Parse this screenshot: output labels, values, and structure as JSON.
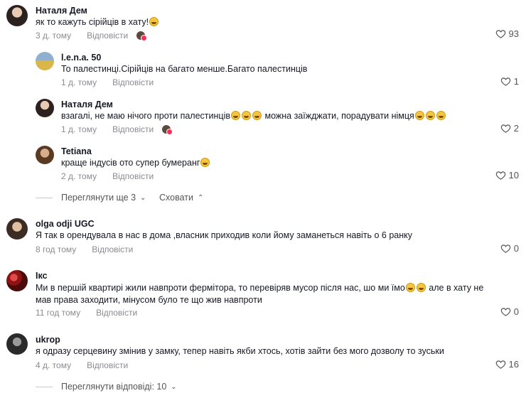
{
  "comments": [
    {
      "username": "Наталя Дем",
      "text": "як то кажуть сірійців в хату!",
      "time": "3 д. тому",
      "reply": "Відповісти",
      "likes": "93"
    },
    {
      "username": "l.e.n.a. 50",
      "text": "То палестинці.Сірійців на багато менше.Багато палестинців",
      "time": "1 д. тому",
      "reply": "Відповісти",
      "likes": "1"
    },
    {
      "username": "Наталя Дем",
      "text_a": "взагалі, не маю нічого проти палестинців",
      "text_b": " можна заїжджати, порадувати німця",
      "time": "1 д. тому",
      "reply": "Відповісти",
      "likes": "2"
    },
    {
      "username": "Tetiana",
      "text": "краще індусів ото супер бумеранг",
      "time": "2 д. тому",
      "reply": "Відповісти",
      "likes": "10"
    },
    {
      "username": "olga odji UGC",
      "text": "Я так в орендувала в нас в дома ,власник приходив коли йому заманеться навіть о 6 ранку",
      "time": "8 год тому",
      "reply": "Відповісти",
      "likes": "0"
    },
    {
      "username": "Ікс",
      "text_a": "Ми в першій квартирі жили навпроти фермітора, то перевіряв мусор після нас, шо ми їмо",
      "text_b": " але в хату не мав права заходити, мінусом було те що жив навпроти",
      "time": "11 год тому",
      "reply": "Відповісти",
      "likes": "0"
    },
    {
      "username": "ukrop",
      "text": "я одразу серцевину змінив у замку, тепер навіть якби хтось, хотів зайти без мого дозволу то зуськи",
      "time": "4 д. тому",
      "reply": "Відповісти",
      "likes": "16"
    }
  ],
  "thread": {
    "view_more": "Переглянути ще 3",
    "hide": "Сховати"
  },
  "footer": {
    "view_replies": "Переглянути відповіді: 10"
  },
  "colors": {
    "meta": "#8a8b91",
    "like_active": "#fe2c55"
  }
}
